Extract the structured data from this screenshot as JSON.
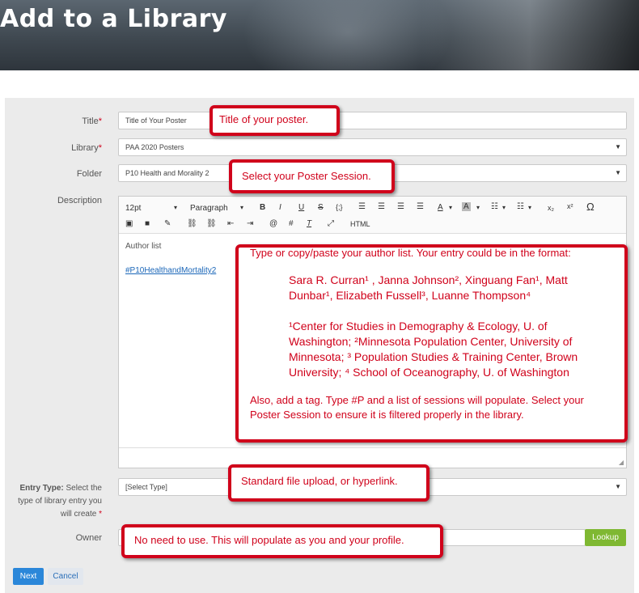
{
  "header": {
    "title": "Add to a Library"
  },
  "form": {
    "title": {
      "label": "Title",
      "required_mark": "*",
      "value": "Title of Your Poster"
    },
    "library": {
      "label": "Library",
      "required_mark": "*",
      "value": "PAA 2020 Posters"
    },
    "folder": {
      "label": "Folder",
      "value": "P10 Health and Morality 2"
    },
    "description": {
      "label": "Description",
      "toolbar": {
        "font_size": "12pt",
        "format": "Paragraph",
        "html_label": "HTML"
      },
      "body_text": "Author list",
      "tag_text": "#P10HealthandMortality2"
    },
    "entry_type": {
      "label_bold": "Entry Type:",
      "label_rest": " Select the type of library entry you will create",
      "required_mark": "*",
      "value": "[Select Type]"
    },
    "owner": {
      "label": "Owner",
      "lookup_label": "Lookup"
    },
    "next_label": "Next",
    "cancel_label": "Cancel"
  },
  "callouts": {
    "title": "Title of your poster.",
    "session": "Select your Poster Session.",
    "author_intro": "Type or copy/paste your author list. Your entry could be in the format:",
    "author_line1": "Sara R. Curran¹ , Janna Johnson², Xinguang Fan¹, Matt",
    "author_line2": "Dunbar¹, Elizabeth Fussell³, Luanne Thompson⁴",
    "affil_line1": "¹Center for Studies in Demography & Ecology, U. of",
    "affil_line2": "Washington; ²Minnesota Population Center, University of",
    "affil_line3": "Minnesota; ³ Population Studies & Training Center, Brown",
    "affil_line4": "University; ⁴ School of Oceanography, U. of Washington",
    "tag_line1": "Also, add a tag. Type #P and a list of sessions will populate. Select your",
    "tag_line2": "Poster Session to ensure it is filtered properly in the library.",
    "upload": "Standard file upload, or hyperlink.",
    "owner": "No need to use. This will populate as you and your profile."
  },
  "colors": {
    "accent": "#d0021b",
    "primary_button": "#2b87d9",
    "lookup_button": "#7fb832"
  }
}
